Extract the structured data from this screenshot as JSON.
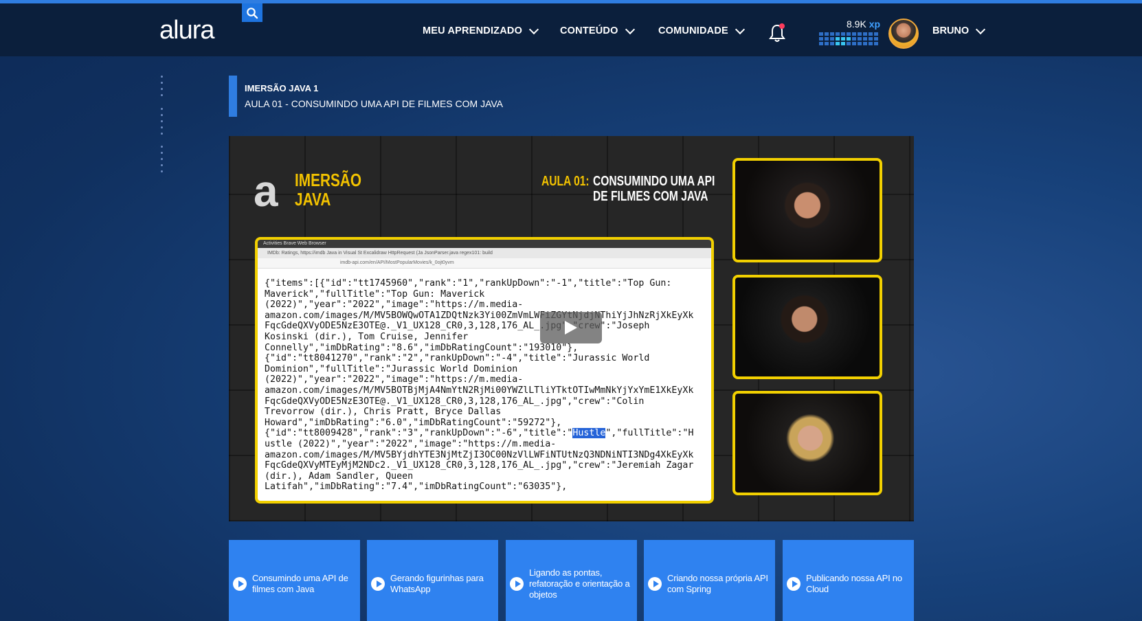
{
  "header": {
    "logo": "alura",
    "nav": [
      {
        "label": "MEU APRENDIZADO"
      },
      {
        "label": "CONTEÚDO"
      },
      {
        "label": "COMUNIDADE"
      }
    ],
    "xp_value": "8.9K",
    "xp_unit": "xp",
    "username": "BRUNO"
  },
  "lesson": {
    "course": "IMERSÃO JAVA 1",
    "title": "AULA 01 - CONSUMINDO UMA API DE FILMES COM JAVA"
  },
  "video": {
    "brand_letter": "a",
    "imersao_line1": "IMERSÃO",
    "imersao_line2": "JAVA",
    "aula_label": "AULA 01:",
    "aula_title_line1": "CONSUMINDO UMA API",
    "aula_title_line2": "DE FILMES COM JAVA",
    "screen_topbar": "Activities   Brave Web Browser",
    "screen_tabs": "IMDb: Ratings,   https://imdb   Java in Visual St   Excalidraw   HttpRequest (Ja   JsonParser.java   regex101: build",
    "screen_url": "imdb-api.com/en/API/MostPopularMovies/k_0ojt0yvm",
    "code_before": "{\"items\":[{\"id\":\"tt1745960\",\"rank\":\"1\",\"rankUpDown\":\"-1\",\"title\":\"Top Gun:\nMaverick\",\"fullTitle\":\"Top Gun: Maverick\n(2022)\",\"year\":\"2022\",\"image\":\"https://m.media-\namazon.com/images/M/MV5BOWQwOTA1ZDQtNzk3Yi00ZmVmLWFiZGYtNjdjNThiYjJhNzRjXkEyXk\nFqcGdeQXVyODE5NzE3OTE@._V1_UX128_CR0,3,128,176_AL_.jpg\",\"crew\":\"Joseph\nKosinski (dir.), Tom Cruise, Jennifer\nConnelly\",\"imDbRating\":\"8.6\",\"imDbRatingCount\":\"193010\"},\n{\"id\":\"tt8041270\",\"rank\":\"2\",\"rankUpDown\":\"-4\",\"title\":\"Jurassic World\nDominion\",\"fullTitle\":\"Jurassic World Dominion\n(2022)\",\"year\":\"2022\",\"image\":\"https://m.media-\namazon.com/images/M/MV5BOTBjMjA4NmYtN2RjMi00YWZlLTliYTktOTIwMmNkYjYxYmE1XkEyXk\nFqcGdeQXVyODE5NzE3OTE@._V1_UX128_CR0,3,128,176_AL_.jpg\",\"crew\":\"Colin\nTrevorrow (dir.), Chris Pratt, Bryce Dallas\nHoward\",\"imDbRating\":\"6.0\",\"imDbRatingCount\":\"59272\"},\n{\"id\":\"tt8009428\",\"rank\":\"3\",\"rankUpDown\":\"-6\",\"title\":\"",
    "code_highlight": "Hustle",
    "code_after": "\",\"fullTitle\":\"H\nustle (2022)\",\"year\":\"2022\",\"image\":\"https://m.media-\namazon.com/images/M/MV5BYjdhYTE3NjMtZjI3OC00NzVlLWFiNTUtNzQ3NDNiNTI3NDg4XkEyXk\nFqcGdeQXVyMTEyMjM2NDc2._V1_UX128_CR0,3,128,176_AL_.jpg\",\"crew\":\"Jeremiah Zagar\n(dir.), Adam Sandler, Queen\nLatifah\",\"imDbRating\":\"7.4\",\"imDbRatingCount\":\"63035\"},"
  },
  "lessons": [
    {
      "label": "Consumindo uma API de filmes com Java"
    },
    {
      "label": "Gerando figurinhas para WhatsApp"
    },
    {
      "label": "Ligando as pontas, refatoração e orientação a objetos"
    },
    {
      "label": "Criando nossa própria API com Spring"
    },
    {
      "label": "Publicando nossa API no Cloud"
    }
  ],
  "colors": {
    "header_bg": "#0b1f3c",
    "accent_blue": "#2f7de1",
    "card_blue": "#2f82f0",
    "video_yellow": "#f2d000"
  }
}
